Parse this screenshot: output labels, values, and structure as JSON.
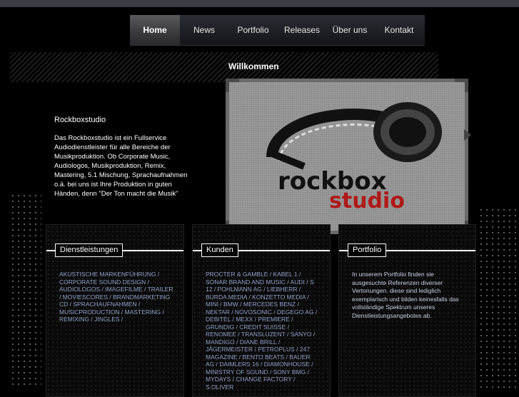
{
  "nav": {
    "items": [
      "Home",
      "News",
      "Portfolio",
      "Releases",
      "Über uns",
      "Kontakt"
    ],
    "active": "Home"
  },
  "main": {
    "heading": "Willkommen",
    "intro_title": "Rockboxstudio",
    "intro_text": "Das Rockboxstudio ist ein Fullservice Audiodienstleister für alle Bereiche der Musikproduktion. Ob Corporate Music, Audiologos, Musikproduktion, Remix, Mastering, 5.1 Mischung, Sprachaufnahmen o.ä. bei uns ist Ihre Produktion in guten Händen, denn \"Der Ton macht die Musik\"",
    "logo": {
      "line1": "rockbox",
      "line2": "studio",
      "color_dark": "#111111",
      "color_red": "#b01818"
    }
  },
  "columns": {
    "services": {
      "label": "Dienstleistungen",
      "text": "AKUSTISCHE MARKENFÜHRUNG / CORPORATE SOUND DESIGN / AUDIOLOGOS / IMAGEFILME / TRAILER / MOVIESCORES / BRANDMARKETING CD / SPRACHAUFNAHMEN / MUSICPRODUCTION / MASTERING / REMIXING / JINGLES /"
    },
    "clients": {
      "label": "Kunden",
      "text": "PROCTER & GAMBLE / KABEL 1 / SONAR BRAND AND MUSIC / AUDI / S 12 / POHLMANN AG / LIEBHERR / BURDA MEDIA / KONZETTO MEDIA / MINI / BMW / MERCEDES BENZ / NEKTAR / NOVOSONIC / DEGEGO AG / DEBITEL / MEXX / PREMIERE / GRUNDIG / CREDIT SUISSE / RENOMEE / TRANSLUZENT / SANYO / MANDIGO / DIANE BRILL / JÄGERMEISTER / PETROPLUS / 247 MAGAZINE / BENTO BEATS / BAUER AG / DAIMLERS 16 / DIAMONHOUSE / MINISTRY OF SOUND / SONY BMG / MYDAYS / CHANGE FACTORY / S.OLIVER"
    },
    "portfolio": {
      "label": "Portfolio",
      "text": "In unserem Portfolio finden sie ausgesuchte Referenzen diverser Vertonungen. diese sind lediglich exemplarisch und bilden keinesfalls das vollständige Spektrum unseres Dienstleistungsangebotes ab."
    }
  },
  "colors": {
    "link_blue": "#8fa0c8",
    "background": "#000000",
    "nav_active": "#4a4a4e"
  }
}
